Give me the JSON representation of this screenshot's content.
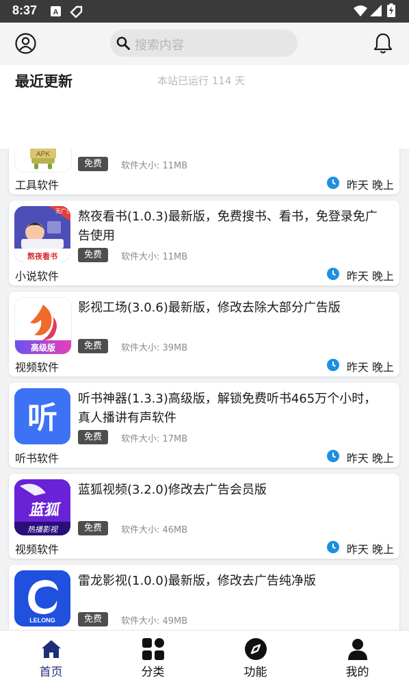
{
  "status_bar": {
    "time": "8:37"
  },
  "header": {
    "search_placeholder": "搜索内容"
  },
  "section": {
    "title": "最近更新",
    "uptime": "本站已运行 114 天"
  },
  "apps": [
    {
      "name": "",
      "badge": "免费",
      "size": "软件大小: 11MB",
      "category": "工具软件",
      "time": "昨天 晚上",
      "icon": "apk-icon"
    },
    {
      "name": "熬夜看书(1.0.3)最新版，免费搜书、看书，免登录免广告使用",
      "badge": "免费",
      "size": "软件大小: 11MB",
      "category": "小说软件",
      "time": "昨天 晚上",
      "icon": "aoye-kanshu-icon",
      "icon_text": "熬夜看书",
      "icon_tag": "无广告"
    },
    {
      "name": "影视工场(3.0.6)最新版，修改去除大部分广告版",
      "badge": "免费",
      "size": "软件大小: 39MB",
      "category": "视频软件",
      "time": "昨天 晚上",
      "icon": "yingshi-gongchang-icon",
      "icon_text": "高级版"
    },
    {
      "name": "听书神器(1.3.3)高级版，解锁免费听书465万个小时，真人播讲有声软件",
      "badge": "免费",
      "size": "软件大小: 17MB",
      "category": "听书软件",
      "time": "昨天 晚上",
      "icon": "tingshu-shenqi-icon",
      "icon_text": "听"
    },
    {
      "name": "蓝狐视频(3.2.0)修改去广告会员版",
      "badge": "免费",
      "size": "软件大小: 46MB",
      "category": "视频软件",
      "time": "昨天 晚上",
      "icon": "lanhu-video-icon",
      "icon_text": "蓝狐",
      "icon_sub": "热播影视"
    },
    {
      "name": "雷龙影视(1.0.0)最新版，修改去广告纯净版",
      "badge": "免费",
      "size": "软件大小: 49MB",
      "category": "",
      "time": "",
      "icon": "leilong-icon",
      "icon_text": "LELONG"
    }
  ],
  "bottom_nav": [
    {
      "label": "首页",
      "icon": "home-icon",
      "active": true
    },
    {
      "label": "分类",
      "icon": "category-icon",
      "active": false
    },
    {
      "label": "功能",
      "icon": "compass-icon",
      "active": false
    },
    {
      "label": "我的",
      "icon": "profile-icon",
      "active": false
    }
  ],
  "colors": {
    "accent": "#1f2d7a",
    "clock": "#1f8fe0",
    "badge": "#4e4e4e"
  }
}
